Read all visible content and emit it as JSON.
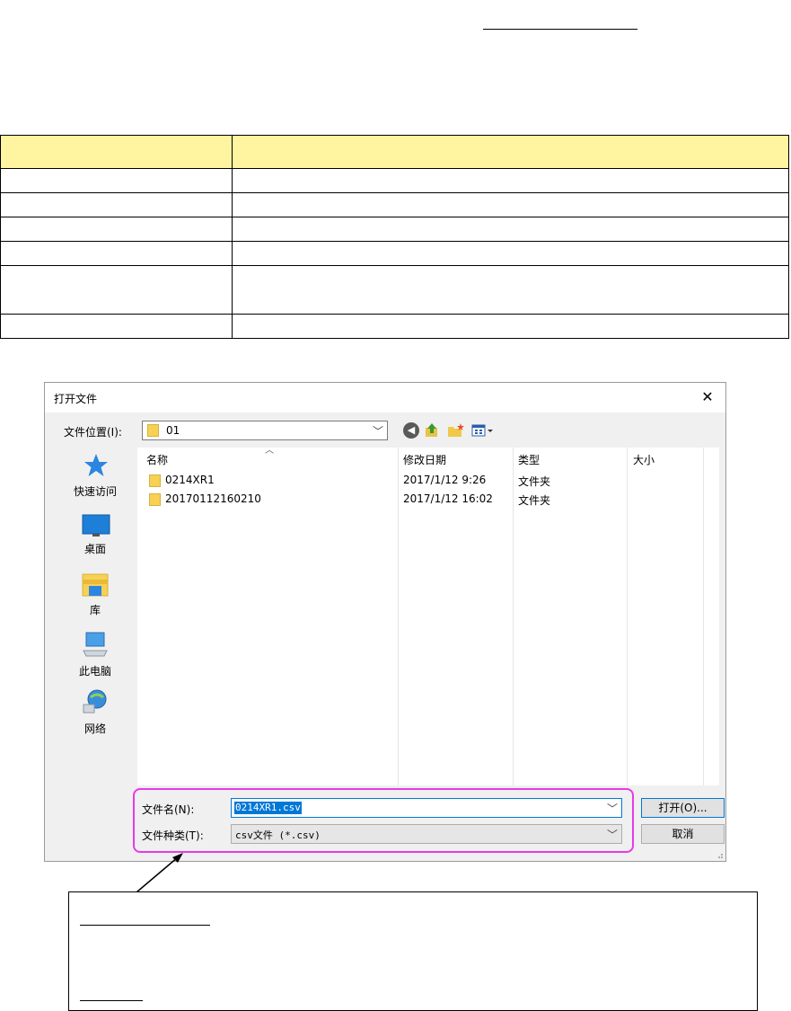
{
  "dialog": {
    "title": "打开文件",
    "close_glyph": "✕",
    "location_label": "文件位置(I):",
    "location_value": "01",
    "places": [
      {
        "label": "快速访问",
        "icon": "star-icon"
      },
      {
        "label": "桌面",
        "icon": "desktop-icon"
      },
      {
        "label": "库",
        "icon": "library-icon"
      },
      {
        "label": "此电脑",
        "icon": "computer-icon"
      },
      {
        "label": "网络",
        "icon": "network-icon"
      }
    ],
    "columns": {
      "name": "名称",
      "date": "修改日期",
      "type": "类型",
      "size": "大小"
    },
    "files": [
      {
        "name": "0214XR1",
        "date": "2017/1/12 9:26",
        "type": "文件夹"
      },
      {
        "name": "20170112160210",
        "date": "2017/1/12 16:02",
        "type": "文件夹"
      }
    ],
    "filename_label": "文件名(N):",
    "filename_value": "0214XR1.csv",
    "filetype_label": "文件种类(T):",
    "filetype_value": "csv文件 (*.csv)",
    "open_button": "打开(O)...",
    "cancel_button": "取消"
  },
  "colors": {
    "table_header": "#fff4a0",
    "highlight": "#e83ae8",
    "selection": "#0078d7"
  }
}
